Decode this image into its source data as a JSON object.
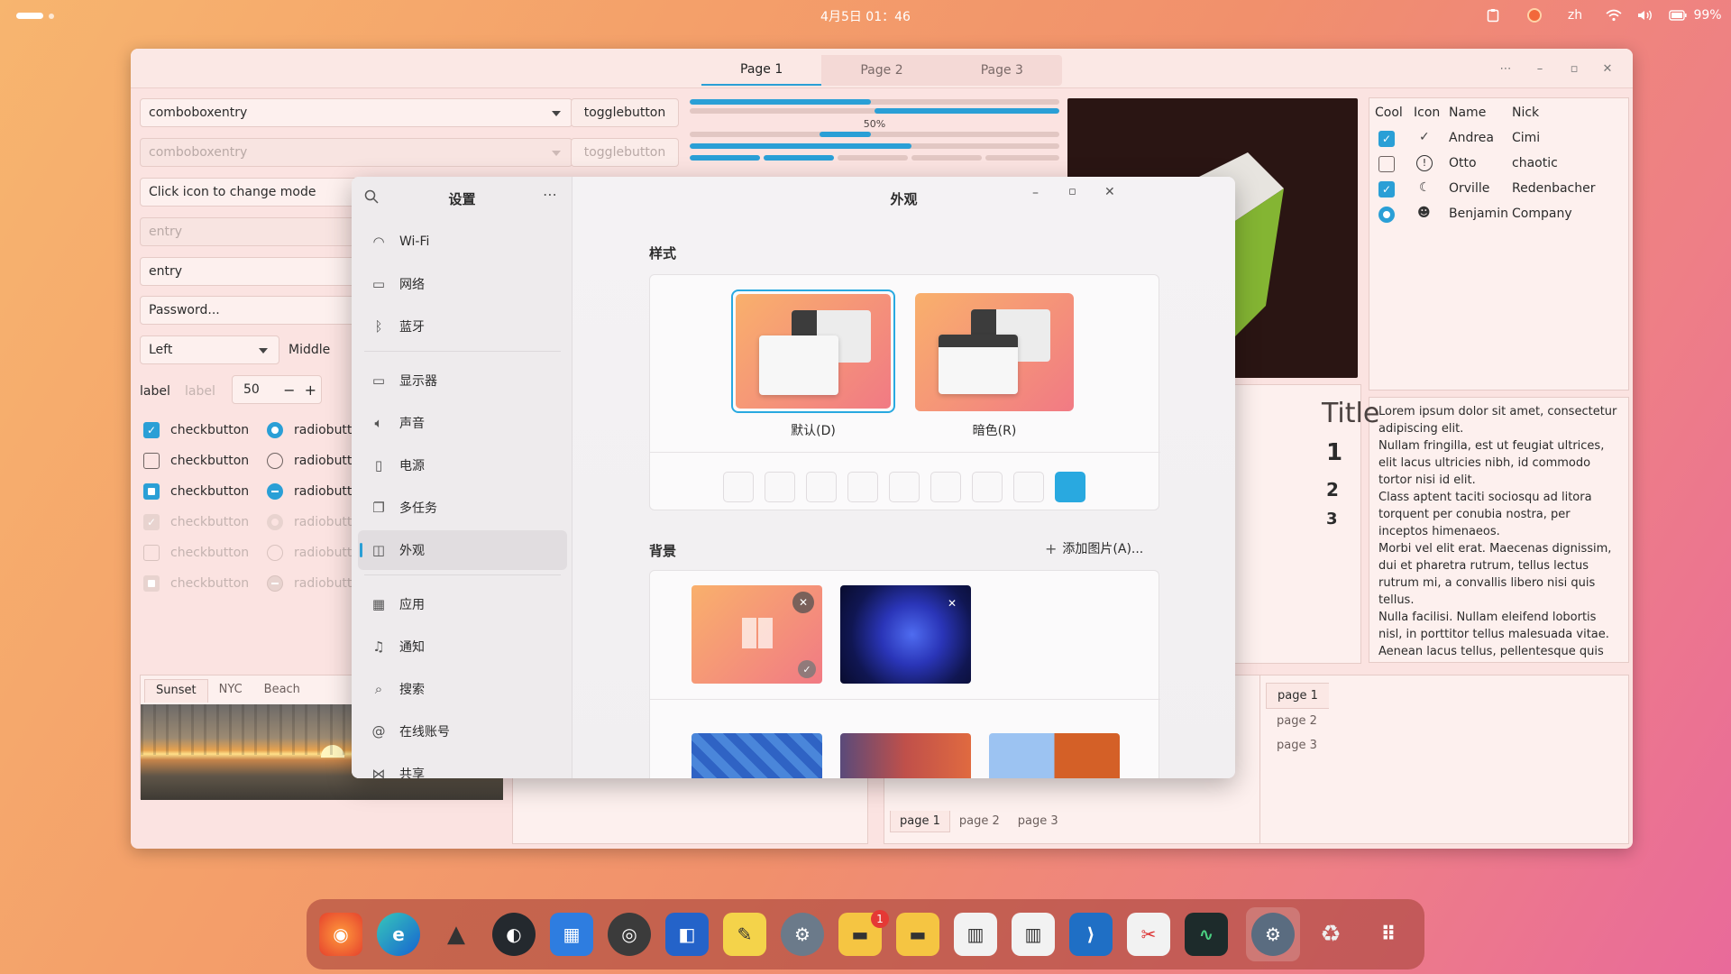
{
  "topbar": {
    "clock": "4月5日 01：46",
    "lang": "zh",
    "battery": "99%"
  },
  "gtk": {
    "tabs": [
      "Page 1",
      "Page 2",
      "Page 3"
    ],
    "combo1": "comboboxentry",
    "combo2": "comboboxentry",
    "toggle1": "togglebutton",
    "toggle2": "togglebutton",
    "entry_mode": "Click icon to change mode",
    "entry_placeholder": "entry",
    "entry_value": "entry",
    "password": "Password...",
    "combo_left": "Left",
    "combo_middle": "Middle",
    "label1": "label",
    "label2": "label",
    "spin_value": "50",
    "progress_label": "50%",
    "check_label": "checkbutton",
    "radio_label": "radiobutto",
    "photo_tabs": [
      "Sunset",
      "NYC",
      "Beach"
    ],
    "tree": {
      "headers": [
        "Cool",
        "Icon",
        "Name",
        "Nick"
      ],
      "rows": [
        {
          "name": "Andrea",
          "nick": "Cimi"
        },
        {
          "name": "Otto",
          "nick": "chaotic"
        },
        {
          "name": "Orville",
          "nick": "Redenbacher"
        },
        {
          "name": "Benjamin",
          "nick": "Company"
        }
      ]
    },
    "lorem": "Lorem ipsum dolor sit amet, consectetur adipiscing elit.\nNullam fringilla, est ut feugiat ultrices, elit lacus ultricies nibh, id commodo tortor nisi id elit.\nClass aptent taciti sociosqu ad litora torquent per conubia nostra, per inceptos himenaeos.\nMorbi vel elit erat. Maecenas dignissim, dui et pharetra rutrum, tellus lectus rutrum mi, a convallis libero nisi quis tellus.\nNulla facilisi. Nullam eleifend lobortis nisl, in porttitor tellus malesuada vitae.\nAenean lacus tellus, pellentesque quis molestie quis, fringilla in arcu.",
    "partial_title": "Title",
    "partial_digits": [
      "1",
      "2",
      "3"
    ],
    "bottom_tabs": [
      "page 1",
      "page 2",
      "page 3"
    ],
    "side_tabs": [
      "page 1",
      "page 2",
      "page 3"
    ]
  },
  "settings": {
    "sidebar_title": "设置",
    "title": "外观",
    "nav": [
      {
        "label": "Wi-Fi",
        "icon": "wifi-icon"
      },
      {
        "label": "网络",
        "icon": "network-icon"
      },
      {
        "label": "蓝牙",
        "icon": "bluetooth-icon"
      },
      {
        "label": "显示器",
        "icon": "display-icon"
      },
      {
        "label": "声音",
        "icon": "sound-icon"
      },
      {
        "label": "电源",
        "icon": "power-icon"
      },
      {
        "label": "多任务",
        "icon": "multitask-icon"
      },
      {
        "label": "外观",
        "icon": "appearance-icon"
      },
      {
        "label": "应用",
        "icon": "apps-icon"
      },
      {
        "label": "通知",
        "icon": "bell-icon"
      },
      {
        "label": "搜索",
        "icon": "search-icon"
      },
      {
        "label": "在线账号",
        "icon": "at-icon"
      },
      {
        "label": "共享",
        "icon": "share-icon"
      }
    ],
    "style_heading": "样式",
    "style_default": "默认(D)",
    "style_dark": "暗色(R)",
    "bg_heading": "背景",
    "add_picture": "添加图片(A)...",
    "accent_color": "#29a9e0"
  },
  "dock": {
    "badge": "1"
  }
}
